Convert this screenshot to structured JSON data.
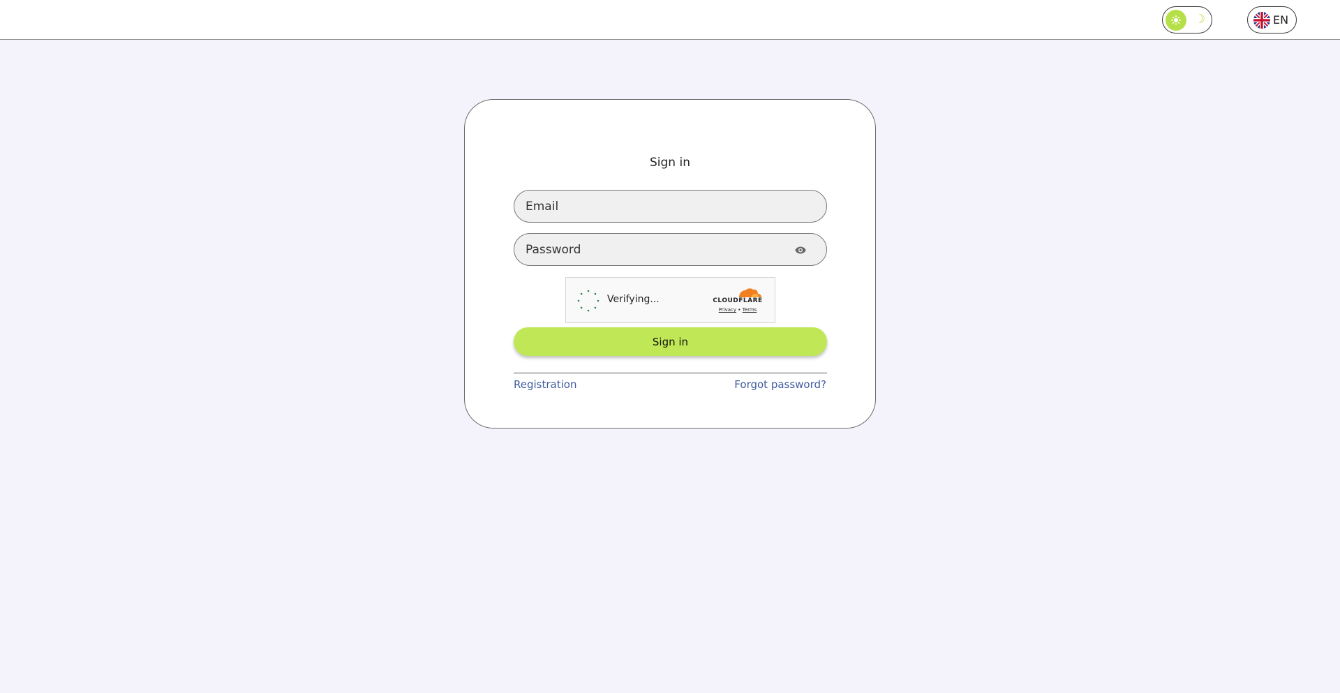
{
  "header": {
    "theme_toggle": {
      "light_icon": "sun-icon",
      "dark_icon": "moon-icon",
      "active": "light",
      "accent": "#b5e04a"
    },
    "language": {
      "label": "EN",
      "flag_icon": "uk-flag-icon"
    }
  },
  "login": {
    "title": "Sign in",
    "email_placeholder": "Email",
    "email_value": "",
    "password_placeholder": "Password",
    "password_value": "",
    "show_password_icon": "eye-icon",
    "captcha": {
      "status": "Verifying...",
      "provider": "CLOUDFLARE",
      "privacy_label": "Privacy",
      "separator": "•",
      "terms_label": "Terms"
    },
    "submit_label": "Sign in",
    "submit_color": "#c0e856",
    "registration_link": "Registration",
    "forgot_link": "Forgot password?",
    "link_color": "#3f5ba0"
  }
}
